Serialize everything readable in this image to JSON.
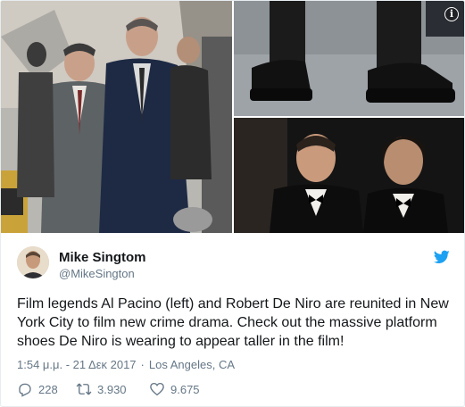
{
  "media": {
    "photos": [
      {
        "name": "set-photo",
        "subject": ""
      },
      {
        "name": "shoes-photo",
        "subject": ""
      },
      {
        "name": "vintage-photo",
        "subject": ""
      }
    ],
    "info_icon": "info-icon"
  },
  "author": {
    "name": "Mike Singtom",
    "handle": "@MikeSington",
    "avatar_icon": "avatar-icon"
  },
  "brand": {
    "icon": "twitter-bird-icon",
    "color": "#1da1f2"
  },
  "tweet": {
    "text": "Film legends Al Pacino (left) and Robert De Niro are reunited in New York City to film new crime drama. Check out the massive platform shoes De Niro is wearing to appear taller in the film!",
    "time": "1:54 μ.μ. - 21 Δεκ 2017",
    "separator": "·",
    "location": "Los Angeles, CA"
  },
  "actions": {
    "replies": "228",
    "retweets": "3.930",
    "likes": "9.675"
  },
  "colors": {
    "text": "#14171a",
    "muted": "#657786",
    "border": "#e6ecf0"
  }
}
